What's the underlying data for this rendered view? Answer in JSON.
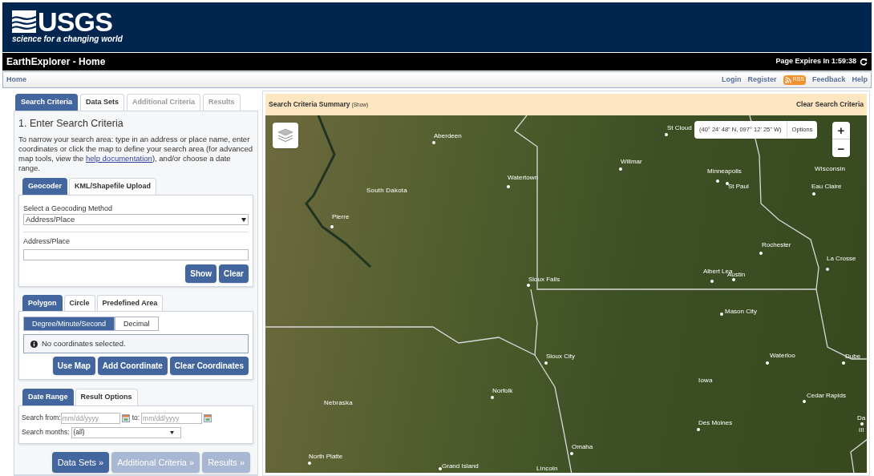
{
  "header": {
    "logo_text": "USGS",
    "tagline": "science for a changing world"
  },
  "title_bar": {
    "title": "EarthExplorer - Home",
    "expires": "Page Expires In 1:59:38"
  },
  "nav": {
    "home": "Home",
    "links": [
      {
        "label": "Login",
        "kind": "link"
      },
      {
        "label": "Register",
        "kind": "link"
      },
      {
        "label": "RSS",
        "kind": "rss"
      },
      {
        "label": "Feedback",
        "kind": "link"
      },
      {
        "label": "Help",
        "kind": "link"
      }
    ]
  },
  "main_tabs": [
    {
      "label": "Search Criteria",
      "selected": true,
      "disabled": false
    },
    {
      "label": "Data Sets",
      "selected": false,
      "disabled": false
    },
    {
      "label": "Additional Criteria",
      "selected": false,
      "disabled": true
    },
    {
      "label": "Results",
      "selected": false,
      "disabled": true
    }
  ],
  "search": {
    "heading": "1. Enter Search Criteria",
    "intro_before": "To narrow your search area: type in an address or place name, enter coordinates or click the map to define your search area (for advanced map tools, view the ",
    "intro_link": "help documentation",
    "intro_after": "), and/or choose a date range."
  },
  "geocoder": {
    "tabs": [
      {
        "label": "Geocoder",
        "selected": true
      },
      {
        "label": "KML/Shapefile Upload",
        "selected": false
      }
    ],
    "method_label": "Select a Geocoding Method",
    "method_value": "Address/Place",
    "address_label": "Address/Place",
    "buttons": [
      "Show",
      "Clear"
    ]
  },
  "area": {
    "tabs": [
      {
        "label": "Polygon",
        "selected": true
      },
      {
        "label": "Circle",
        "selected": false
      },
      {
        "label": "Predefined Area",
        "selected": false
      }
    ],
    "formats": [
      {
        "label": "Degree/Minute/Second",
        "selected": true
      },
      {
        "label": "Decimal",
        "selected": false
      }
    ],
    "message": "No coordinates selected.",
    "buttons": [
      "Use Map",
      "Add Coordinate",
      "Clear Coordinates"
    ]
  },
  "dates": {
    "tabs": [
      {
        "label": "Date Range",
        "selected": true
      },
      {
        "label": "Result Options",
        "selected": false
      }
    ],
    "from_label": "Search from:",
    "from_placeholder": "mm/dd/yyyy",
    "to_label": "to:",
    "to_placeholder": "mm/dd/yyyy",
    "months_label": "Search months:",
    "months_value": "(all)"
  },
  "step_buttons": [
    {
      "label": "Data Sets »",
      "disabled": false
    },
    {
      "label": "Additional Criteria »",
      "disabled": true
    },
    {
      "label": "Results »",
      "disabled": true
    }
  ],
  "map": {
    "summary_title": "Search Criteria Summary",
    "summary_toggle": "(Show)",
    "clear": "Clear Search Criteria",
    "coords": "(40° 24' 48\" N, 097° 12' 25\" W)",
    "options": "Options",
    "zoom_in": "+",
    "zoom_out": "−",
    "labels": [
      {
        "text": "St Cloud",
        "kind": "city"
      },
      {
        "text": "Aberdeen",
        "kind": "city"
      },
      {
        "text": "Willmar",
        "kind": "city"
      },
      {
        "text": "Minneapolis",
        "kind": "city"
      },
      {
        "text": "St Paul",
        "kind": "city"
      },
      {
        "text": "Wisconsin",
        "kind": "region"
      },
      {
        "text": "Eau Claire",
        "kind": "city"
      },
      {
        "text": "Watertown",
        "kind": "city"
      },
      {
        "text": "South Dakota",
        "kind": "region"
      },
      {
        "text": "Pierre",
        "kind": "city"
      },
      {
        "text": "Rochester",
        "kind": "city"
      },
      {
        "text": "La Crosse",
        "kind": "city"
      },
      {
        "text": "Albert Lea",
        "kind": "city"
      },
      {
        "text": "Austin",
        "kind": "city"
      },
      {
        "text": "Sioux Falls",
        "kind": "city"
      },
      {
        "text": "Mason City",
        "kind": "city"
      },
      {
        "text": "Sioux City",
        "kind": "city"
      },
      {
        "text": "Waterloo",
        "kind": "city"
      },
      {
        "text": "Iowa",
        "kind": "region"
      },
      {
        "text": "Norfolk",
        "kind": "city"
      },
      {
        "text": "Nebraska",
        "kind": "region"
      },
      {
        "text": "Cedar Rapids",
        "kind": "city"
      },
      {
        "text": "Des Moines",
        "kind": "city"
      },
      {
        "text": "Omaha",
        "kind": "city"
      },
      {
        "text": "North Platte",
        "kind": "city"
      },
      {
        "text": "Grand Island",
        "kind": "city"
      },
      {
        "text": "Lincoln",
        "kind": "region"
      },
      {
        "text": "Dube",
        "kind": "city"
      },
      {
        "text": "Da",
        "kind": "city"
      },
      {
        "text": "Ill",
        "kind": "region"
      }
    ]
  }
}
